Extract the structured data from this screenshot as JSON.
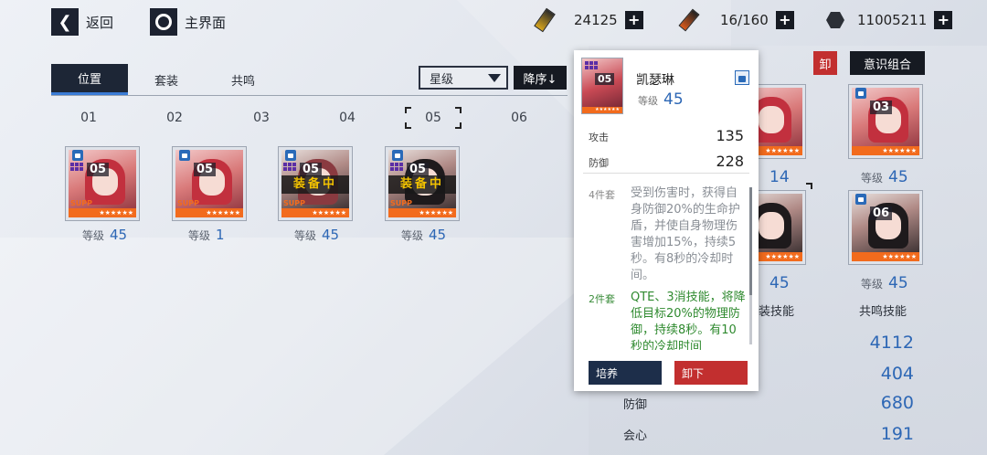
{
  "header": {
    "back_label": "返回",
    "home_label": "主界面",
    "resources": [
      {
        "icon": "gold-ticket-icon",
        "value": "24125"
      },
      {
        "icon": "stamina-battery-icon",
        "value": "16/160"
      },
      {
        "icon": "gear-nut-icon",
        "value": "11005211"
      }
    ]
  },
  "tabs": [
    {
      "label": "位置",
      "active": true
    },
    {
      "label": "套装",
      "active": false
    },
    {
      "label": "共鸣",
      "active": false
    }
  ],
  "filter": {
    "selected": "星级",
    "sort_label": "降序↓"
  },
  "slots": [
    "01",
    "02",
    "03",
    "04",
    "05",
    "06"
  ],
  "cards": [
    {
      "number": "05",
      "equipped": false,
      "level_label": "等级",
      "level": "45",
      "sup": "SUPP"
    },
    {
      "number": "05",
      "equipped": false,
      "level_label": "等级",
      "level": "1",
      "sup": "SUPP"
    },
    {
      "number": "05",
      "equipped": true,
      "equipped_label": "装备中",
      "level_label": "等级",
      "level": "45",
      "sup": "SUPP"
    },
    {
      "number": "05",
      "equipped": true,
      "equipped_label": "装备中",
      "level_label": "等级",
      "level": "45",
      "sup": "SUPP"
    }
  ],
  "card_stars": "★★★★★★",
  "popup": {
    "number": "05",
    "name": "凯瑟琳",
    "level_label": "等级",
    "level": "45",
    "stats": [
      {
        "label": "攻击",
        "value": "135"
      },
      {
        "label": "防御",
        "value": "228"
      }
    ],
    "set4_label": "4件套",
    "set4_text": "受到伤害时，获得自身防御20%的生命护盾，并使自身物理伤害增加15%，持续5秒。有8秒的冷却时间。",
    "set2_label": "2件套",
    "set2_text": "QTE、3消技能，将降低目标20%的物理防御，持续8秒。有10秒的冷却时间",
    "train_label": "培养",
    "unequip_label": "卸下"
  },
  "right": {
    "unload_label": "卸",
    "combo_label": "意识组合",
    "cards": [
      {
        "number": "03",
        "level_label": "等级",
        "level": "45"
      },
      {
        "number": "06",
        "level_label": "等级",
        "level": "45"
      }
    ],
    "partial_levels": [
      "45",
      "14",
      "45"
    ],
    "partial_level_label": "45",
    "partial_skill_label": "装技能",
    "resonance_skill_label": "共鸣技能",
    "stats": [
      {
        "label": "",
        "value": "4112"
      },
      {
        "label": "",
        "value": "404"
      },
      {
        "label": "防御",
        "value": "680"
      },
      {
        "label": "会心",
        "value": "191"
      }
    ]
  },
  "colors": {
    "accent_blue": "#2d67b5",
    "dark": "#161a22",
    "red": "#c22f2f",
    "orange": "#f26b1d",
    "equip_yellow": "#f2c200"
  }
}
